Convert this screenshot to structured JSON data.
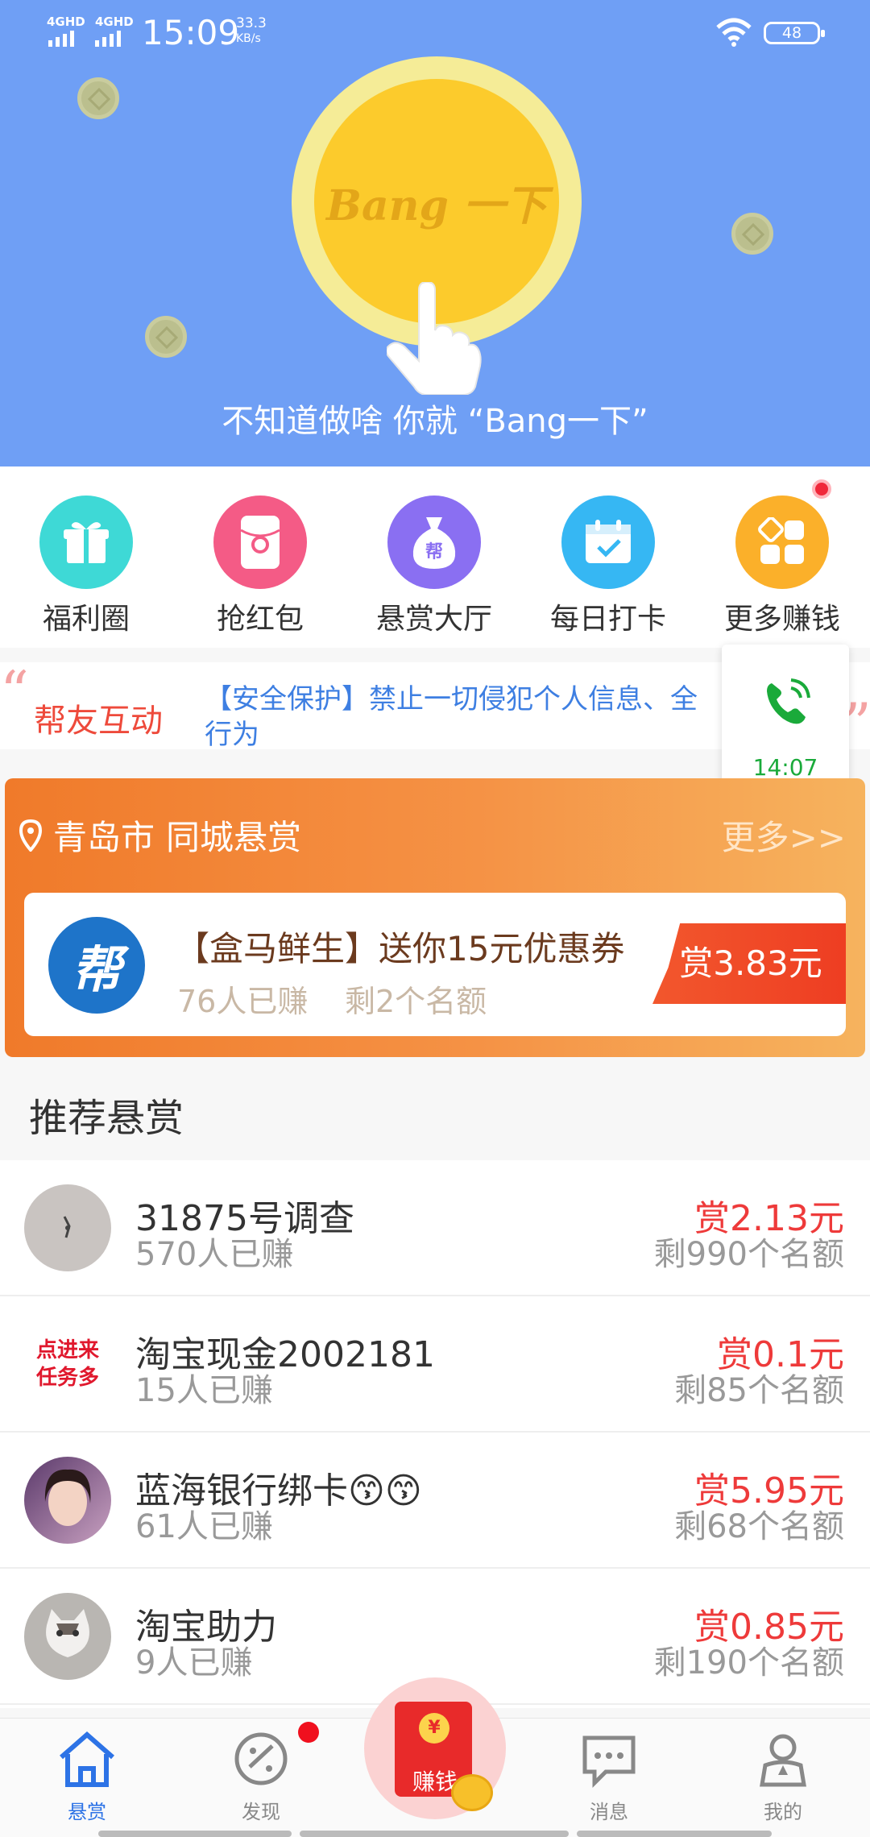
{
  "status_bar": {
    "time": "15:09",
    "net_speed_value": "33.3",
    "net_speed_unit": "KB/s",
    "signal1": "4GHD",
    "signal2": "4GHD",
    "battery": "48"
  },
  "hero": {
    "coin_label": "Bang 一下",
    "tagline": "不知道做啥 你就 “Bang一下”"
  },
  "quick_menu": [
    {
      "label": "福利圈",
      "icon": "gift-icon",
      "color": "#3ed9d6"
    },
    {
      "label": "抢红包",
      "icon": "red-packet-icon",
      "color": "#f45b86"
    },
    {
      "label": "悬赏大厅",
      "icon": "money-bag-icon",
      "color": "#8a6ff2"
    },
    {
      "label": "每日打卡",
      "icon": "calendar-check-icon",
      "color": "#36b7f3"
    },
    {
      "label": "更多赚钱",
      "icon": "grid-more-icon",
      "color": "#fbb02a"
    }
  ],
  "notice": {
    "title": "帮友互动",
    "message": "【安全保护】禁止一切侵犯个人信息、全行为"
  },
  "call_float": {
    "time": "14:07"
  },
  "city_card": {
    "city": "青岛市",
    "label": "同城悬赏",
    "more": "更多>>",
    "logo_text": "帮",
    "deal_title": "【盒马鲜生】送你15元优惠券",
    "earned": "76人已赚",
    "quota": "剩2个名额",
    "reward": "赏3.83元"
  },
  "recommend": {
    "title": "推荐悬赏",
    "rows": [
      {
        "name": "31875号调查",
        "earned": "570人已赚",
        "reward": "赏2.13元",
        "quota": "剩990个名额"
      },
      {
        "name": "淘宝现金2002181",
        "earned": "15人已赚",
        "reward": "赏0.1元",
        "quota": "剩85个名额",
        "avatar_text": "点进来\n任务多"
      },
      {
        "name": "蓝海银行绑卡😙😙",
        "earned": "61人已赚",
        "reward": "赏5.95元",
        "quota": "剩68个名额"
      },
      {
        "name": "淘宝助力",
        "earned": "9人已赚",
        "reward": "赏0.85元",
        "quota": "剩190个名额"
      }
    ]
  },
  "tabbar": {
    "home": "悬赏",
    "discover": "发现",
    "earn": "赚钱",
    "earn_symbol": "¥",
    "messages": "消息",
    "mine": "我的"
  },
  "colors": {
    "hero_bg": "#6f9ff5",
    "accent_blue": "#2d73e6",
    "reward_red": "#ee3a3a",
    "city_orange": "#f07a2a"
  }
}
